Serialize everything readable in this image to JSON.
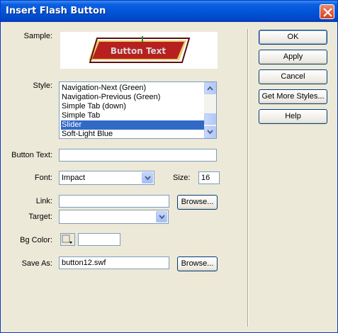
{
  "window": {
    "title": "Insert Flash Button"
  },
  "labels": {
    "sample": "Sample:",
    "style": "Style:",
    "button_text": "Button Text:",
    "font": "Font:",
    "size": "Size:",
    "link": "Link:",
    "target": "Target:",
    "bg_color": "Bg Color:",
    "save_as": "Save As:"
  },
  "sample_preview": {
    "text": "Button Text"
  },
  "style_list": {
    "items": [
      "Navigation-Next (Green)",
      "Navigation-Previous (Green)",
      "Simple Tab (down)",
      "Simple Tab",
      "Slider",
      "Soft-Light Blue"
    ],
    "selected": "Slider"
  },
  "fields": {
    "button_text": "",
    "font": "Impact",
    "size": "16",
    "link": "",
    "target": "",
    "bg_color": "",
    "save_as": "button12.swf"
  },
  "buttons": {
    "ok": "OK",
    "apply": "Apply",
    "cancel": "Cancel",
    "get_more_styles": "Get More Styles...",
    "help": "Help",
    "browse_link": "Browse...",
    "browse_save": "Browse..."
  },
  "colors": {
    "titlebar": "#0355d8",
    "dialog_bg": "#ece9d8",
    "selection": "#316ac5",
    "close_button": "#d4401e"
  }
}
